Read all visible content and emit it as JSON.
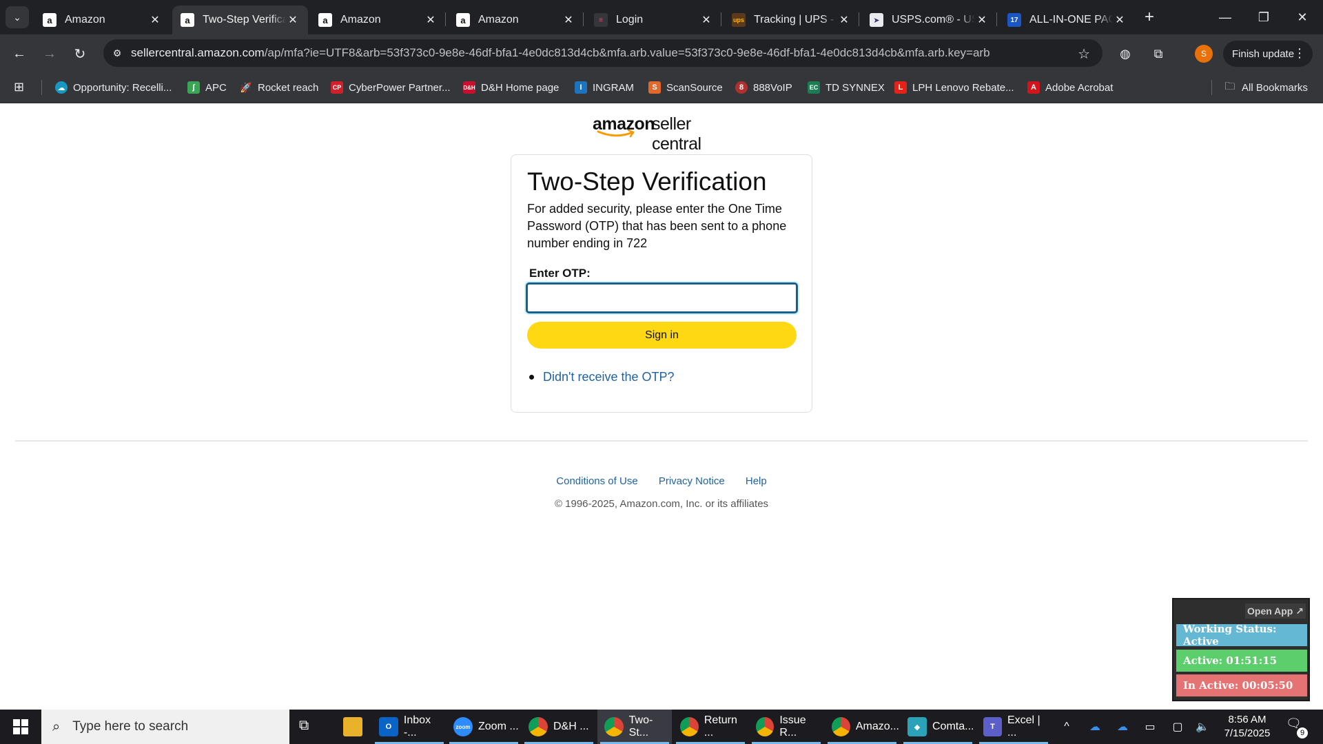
{
  "browser": {
    "tabs": [
      {
        "title": "Amazon",
        "favicon": "amazon-icon",
        "active": false
      },
      {
        "title": "Two-Step Verification",
        "favicon": "amazon-icon",
        "active": true
      },
      {
        "title": "Amazon",
        "favicon": "amazon-icon",
        "active": false
      },
      {
        "title": "Amazon",
        "favicon": "amazon-icon",
        "active": false
      },
      {
        "title": "Login",
        "favicon": "login-icon",
        "active": false
      },
      {
        "title": "Tracking | UPS - U",
        "favicon": "ups-icon",
        "active": false
      },
      {
        "title": "USPS.com® - USPS",
        "favicon": "usps-icon",
        "active": false
      },
      {
        "title": "ALL-IN-ONE PACKAGE",
        "favicon": "seventeen-track-icon",
        "active": false
      }
    ],
    "url_host": "sellercentral.amazon.com",
    "url_path": "/ap/mfa?ie=UTF8&arb=53f373c0-9e8e-46df-bfa1-4e0dc813d4cb&mfa.arb.value=53f373c0-9e8e-46df-bfa1-4e0dc813d4cb&mfa.arb.key=arb",
    "profile_initial": "S",
    "finish_update_label": "Finish update",
    "bookmarks": [
      {
        "label": "Opportunity: Recelli...",
        "icon": "salesforce-icon",
        "color": "#1798c1"
      },
      {
        "label": "APC",
        "icon": "apc-icon",
        "color": "#3aa655"
      },
      {
        "label": "Rocket reach",
        "icon": "rocket-icon",
        "color": "#5a6bd8"
      },
      {
        "label": "CyberPower Partner...",
        "icon": "cyberpower-icon",
        "color": "#d0202a"
      },
      {
        "label": "D&H Home page",
        "icon": "dh-icon",
        "color": "#c8102e"
      },
      {
        "label": "INGRAM",
        "icon": "ingram-icon",
        "color": "#1e73be"
      },
      {
        "label": "ScanSource",
        "icon": "scansource-icon",
        "color": "#e0682b"
      },
      {
        "label": "888VoIP",
        "icon": "voip-icon",
        "color": "#b03030"
      },
      {
        "label": "TD SYNNEX",
        "icon": "tdsynnex-icon",
        "color": "#1c7c54"
      },
      {
        "label": "LPH Lenovo Rebate...",
        "icon": "lenovo-icon",
        "color": "#e2231a"
      },
      {
        "label": "Adobe Acrobat",
        "icon": "acrobat-icon",
        "color": "#d4141d"
      }
    ],
    "all_bookmarks_label": "All Bookmarks"
  },
  "page": {
    "logo_amazon": "amazon",
    "logo_suffix": "seller central",
    "heading": "Two-Step Verification",
    "description": "For added security, please enter the One Time Password (OTP) that has been sent to a phone number ending in 722",
    "otp_label": "Enter OTP:",
    "otp_value": "",
    "signin_label": "Sign in",
    "resend_link": "Didn't receive the OTP?",
    "footer_links": [
      "Conditions of Use",
      "Privacy Notice",
      "Help"
    ],
    "copyright": "© 1996-2025, Amazon.com, Inc. or its affiliates",
    "accent_button_color": "#ffd814",
    "link_color": "#2162a1"
  },
  "widget": {
    "open_app_label": "Open App ↗",
    "working_status": "Working Status: Active",
    "active_time": "Active: 01:51:15",
    "inactive_time": "In Active: 00:05:50"
  },
  "taskbar": {
    "search_placeholder": "Type here to search",
    "apps": [
      {
        "label": "Inbox -...",
        "icon": "outlook-icon",
        "color": "#0a64c8",
        "active": false
      },
      {
        "label": "Zoom ...",
        "icon": "zoom-icon",
        "color": "#2d8cff",
        "active": false
      },
      {
        "label": "D&H ...",
        "icon": "chrome-icon",
        "color": "#db4437",
        "active": false
      },
      {
        "label": "Two-St...",
        "icon": "chrome-icon",
        "color": "#db4437",
        "active": true
      },
      {
        "label": "Return ...",
        "icon": "chrome-icon",
        "color": "#db4437",
        "active": false
      },
      {
        "label": "Issue R...",
        "icon": "chrome-icon",
        "color": "#db4437",
        "active": false
      },
      {
        "label": "Amazo...",
        "icon": "chrome-icon",
        "color": "#db4437",
        "active": false
      },
      {
        "label": "Comta...",
        "icon": "comtrade-icon",
        "color": "#2aa3b8",
        "active": false
      },
      {
        "label": "Excel | ...",
        "icon": "teams-icon",
        "color": "#5b5fc7",
        "active": false
      }
    ],
    "time": "8:56 AM",
    "date": "7/15/2025",
    "notification_count": "9"
  }
}
